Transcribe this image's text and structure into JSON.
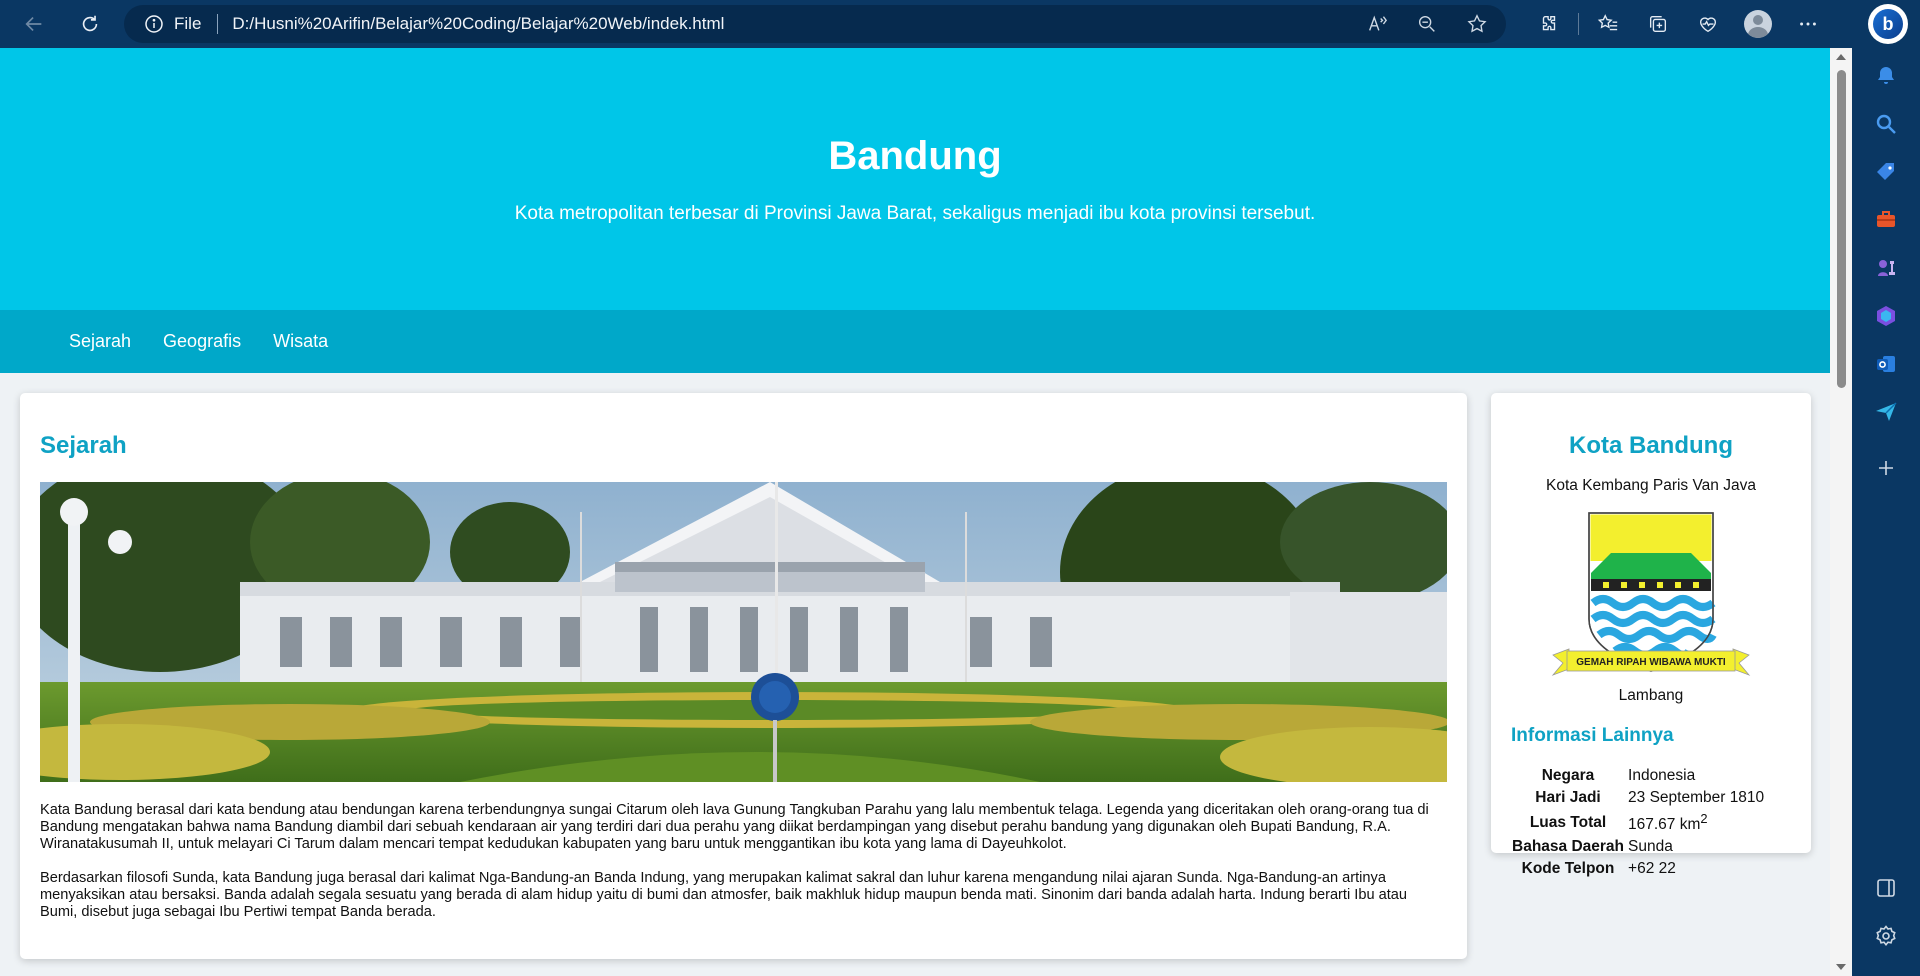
{
  "browser": {
    "scheme_label": "File",
    "url": "D:/Husni%20Arifin/Belajar%20Coding/Belajar%20Web/indek.html",
    "accent": "#0a3763"
  },
  "page": {
    "hero": {
      "title": "Bandung",
      "subtitle": "Kota metropolitan terbesar di Provinsi Jawa Barat, sekaligus menjadi ibu kota provinsi tersebut.",
      "bg_color": "#00c6e8"
    },
    "nav": {
      "bg_color": "#00a8c9",
      "items": [
        {
          "label": "Sejarah"
        },
        {
          "label": "Geografis"
        },
        {
          "label": "Wisata"
        }
      ]
    },
    "main": {
      "heading": "Sejarah",
      "paragraphs": [
        "Kata Bandung berasal dari kata bendung atau bendungan karena terbendungnya sungai Citarum oleh lava Gunung Tangkuban Parahu yang lalu membentuk telaga. Legenda yang diceritakan oleh orang-orang tua di Bandung mengatakan bahwa nama Bandung diambil dari sebuah kendaraan air yang terdiri dari dua perahu yang diikat berdampingan yang disebut perahu bandung yang digunakan oleh Bupati Bandung, R.A. Wiranatakusumah II, untuk melayari Ci Tarum dalam mencari tempat kedudukan kabupaten yang baru untuk menggantikan ibu kota yang lama di Dayeuhkolot.",
        "Berdasarkan filosofi Sunda, kata Bandung juga berasal dari kalimat Nga-Bandung-an Banda Indung, yang merupakan kalimat sakral dan luhur karena mengandung nilai ajaran Sunda. Nga-Bandung-an artinya menyaksikan atau bersaksi. Banda adalah segala sesuatu yang berada di alam hidup yaitu di bumi dan atmosfer, baik makhluk hidup maupun benda mati. Sinonim dari banda adalah harta. Indung berarti Ibu atau Bumi, disebut juga sebagai Ibu Pertiwi tempat Banda berada."
      ]
    },
    "aside": {
      "title": "Kota Bandung",
      "motto": "Kota Kembang Paris Van Java",
      "emblem_ribbon": "GEMAH RIPAH WIBAWA MUKTI",
      "emblem_caption": "Lambang",
      "info_heading": "Informasi Lainnya",
      "info_rows": [
        {
          "label": "Negara",
          "value": "Indonesia"
        },
        {
          "label": "Hari Jadi",
          "value": "23 September 1810"
        },
        {
          "label": "Luas Total",
          "value": "167.67 km",
          "sup": "2"
        },
        {
          "label": "Bahasa Daerah",
          "value": "Sunda"
        },
        {
          "label": "Kode Telpon",
          "value": "+62 22"
        }
      ]
    },
    "heading_color": "#0fa2c4"
  }
}
